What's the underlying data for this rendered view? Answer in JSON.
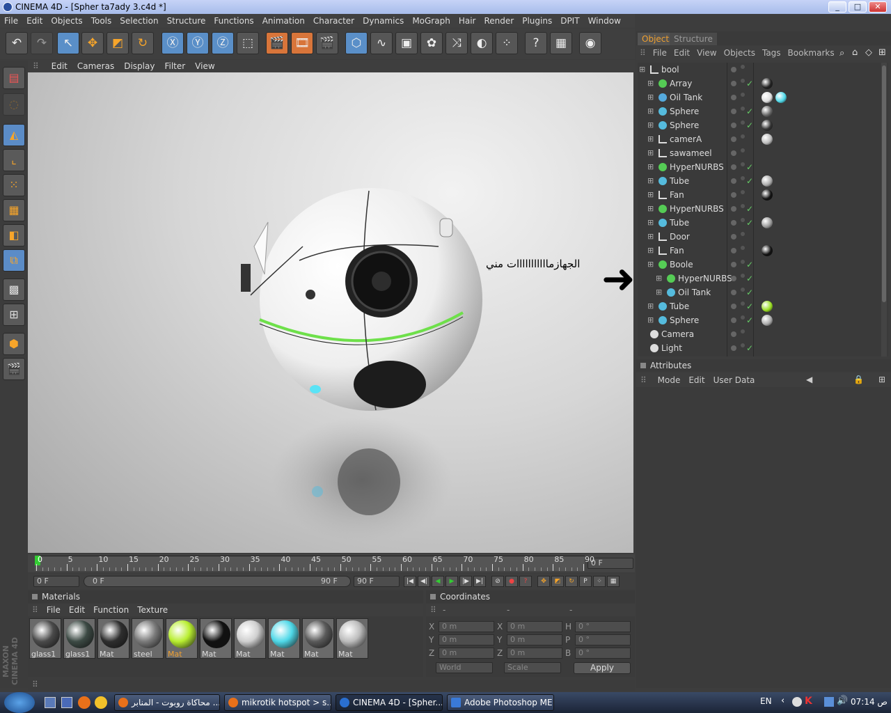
{
  "window": {
    "title": "CINEMA 4D - [Spher ta7ady 3.c4d *]",
    "min": "_",
    "max": "□",
    "close": "✕"
  },
  "menubar": [
    "File",
    "Edit",
    "Objects",
    "Tools",
    "Selection",
    "Structure",
    "Functions",
    "Animation",
    "Character",
    "Dynamics",
    "MoGraph",
    "Hair",
    "Render",
    "Plugins",
    "DPIT",
    "Window",
    "Help"
  ],
  "viewport": {
    "menu": [
      "Edit",
      "Cameras",
      "Display",
      "Filter",
      "View"
    ],
    "annotation": "الجهازمااااااااااات مني",
    "arrow": "➜"
  },
  "timeline": {
    "ticks": [
      "0",
      "5",
      "10",
      "15",
      "20",
      "25",
      "30",
      "35",
      "40",
      "45",
      "50",
      "55",
      "60",
      "65",
      "70",
      "75",
      "80",
      "85",
      "90"
    ],
    "current_frame": "0 F",
    "start": "0 F",
    "range_start": "0 F",
    "range_end": "90 F",
    "end": "90 F"
  },
  "materials": {
    "title": "Materials",
    "menu": [
      "File",
      "Edit",
      "Function",
      "Texture"
    ],
    "items": [
      {
        "name": "glass1",
        "color": "#4a4a4a"
      },
      {
        "name": "glass1",
        "color": "#3c4a44"
      },
      {
        "name": "Mat",
        "color": "#2e2e2e"
      },
      {
        "name": "steel",
        "color": "#7a7a7a"
      },
      {
        "name": "Mat",
        "color": "#b8ee30",
        "selected": true
      },
      {
        "name": "Mat",
        "color": "#111111"
      },
      {
        "name": "Mat",
        "color": "#cfcfcf"
      },
      {
        "name": "Mat",
        "color": "#4fd8e8"
      },
      {
        "name": "Mat",
        "color": "#5a5a5a"
      },
      {
        "name": "Mat",
        "color": "#bcbcbc"
      }
    ]
  },
  "coordinates": {
    "title": "Coordinates",
    "col_headers": [
      "-",
      "-",
      "-"
    ],
    "rows": [
      {
        "a": "X",
        "av": "0 m",
        "b": "X",
        "bv": "0 m",
        "c": "H",
        "cv": "0 °"
      },
      {
        "a": "Y",
        "av": "0 m",
        "b": "Y",
        "bv": "0 m",
        "c": "P",
        "cv": "0 °"
      },
      {
        "a": "Z",
        "av": "0 m",
        "b": "Z",
        "bv": "0 m",
        "c": "B",
        "cv": "0 °"
      }
    ],
    "world": "World",
    "scale": "Scale",
    "apply": "Apply"
  },
  "objects": {
    "tabs": [
      "Objects",
      "Structure"
    ],
    "menu": [
      "File",
      "Edit",
      "View",
      "Objects",
      "Tags",
      "Bookmarks"
    ],
    "rows": [
      {
        "name": "bool",
        "indent": 0,
        "icon": "null",
        "check": false,
        "tags": []
      },
      {
        "name": "Array",
        "indent": 1,
        "icon": "array",
        "check": true,
        "tags": [
          "#222"
        ]
      },
      {
        "name": "Oil Tank",
        "indent": 1,
        "icon": "oiltank",
        "check": false,
        "tags": [
          "#ddd",
          "#4fd8e8"
        ]
      },
      {
        "name": "Sphere",
        "indent": 1,
        "icon": "sphere",
        "check": true,
        "tags": [
          "#666"
        ]
      },
      {
        "name": "Sphere",
        "indent": 1,
        "icon": "sphere",
        "check": true,
        "tags": [
          "#333"
        ]
      },
      {
        "name": "camerA",
        "indent": 1,
        "icon": "null",
        "check": false,
        "tags": [
          "#bbb"
        ]
      },
      {
        "name": "sawameel",
        "indent": 1,
        "icon": "null",
        "check": false,
        "tags": []
      },
      {
        "name": "HyperNURBS",
        "indent": 1,
        "icon": "nurbs",
        "check": true,
        "tags": []
      },
      {
        "name": "Tube",
        "indent": 1,
        "icon": "tube",
        "check": true,
        "tags": [
          "#aaa"
        ]
      },
      {
        "name": "Fan",
        "indent": 1,
        "icon": "null",
        "check": false,
        "tags": [
          "#111"
        ]
      },
      {
        "name": "HyperNURBS",
        "indent": 1,
        "icon": "nurbs",
        "check": true,
        "tags": []
      },
      {
        "name": "Tube",
        "indent": 1,
        "icon": "tube",
        "check": true,
        "tags": [
          "#999"
        ]
      },
      {
        "name": "Door",
        "indent": 1,
        "icon": "null",
        "check": false,
        "tags": []
      },
      {
        "name": "Fan",
        "indent": 1,
        "icon": "null",
        "check": false,
        "tags": [
          "#111"
        ]
      },
      {
        "name": "Boole",
        "indent": 1,
        "icon": "boole",
        "check": true,
        "tags": []
      },
      {
        "name": "HyperNURBS",
        "indent": 2,
        "icon": "nurbs",
        "check": true,
        "tags": []
      },
      {
        "name": "Oil Tank",
        "indent": 2,
        "icon": "tube",
        "check": true,
        "tags": []
      },
      {
        "name": "Tube",
        "indent": 1,
        "icon": "tube",
        "check": true,
        "tags": [
          "#9d2"
        ]
      },
      {
        "name": "Sphere",
        "indent": 1,
        "icon": "sphere",
        "check": true,
        "tags": [
          "#aaa"
        ]
      },
      {
        "name": "Camera",
        "indent": 0,
        "icon": "camera",
        "check": false,
        "tags": []
      },
      {
        "name": "Light",
        "indent": 0,
        "icon": "light",
        "check": true,
        "tags": []
      }
    ]
  },
  "attributes": {
    "title": "Attributes",
    "menu": [
      "Mode",
      "Edit",
      "User Data"
    ]
  },
  "taskbar": {
    "tasks": [
      "محاكاة روبوت - المنابر ...",
      "mikrotik hotspot > s...",
      "CINEMA 4D - [Spher...",
      "Adobe Photoshop ME"
    ],
    "lang": "EN",
    "time": "07:14 ص"
  },
  "colors": {
    "accent": "#f0a030",
    "tool_blue": "#5a8fc8",
    "tool_orange": "#d8753a",
    "ring": "#6ee04a"
  }
}
